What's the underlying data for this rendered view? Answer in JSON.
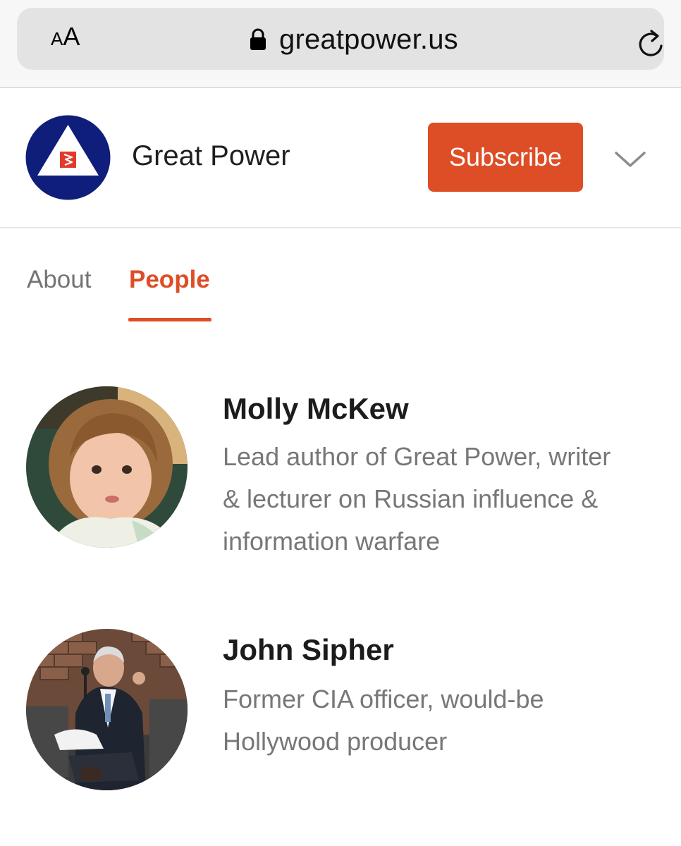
{
  "browser": {
    "text_size_small": "A",
    "text_size_large": "A",
    "url": "greatpower.us"
  },
  "site": {
    "title": "Great Power",
    "subscribe_label": "Subscribe",
    "accent_color": "#dd4e27",
    "logo_colors": {
      "ring": "#0f1e7a",
      "triangle": "#ffffff",
      "emblem": "#e23a2c"
    }
  },
  "tabs": [
    {
      "label": "About",
      "active": false
    },
    {
      "label": "People",
      "active": true
    }
  ],
  "people": [
    {
      "name": "Molly McKew",
      "bio_lines": [
        "Lead author of Great Power, writer",
        "& lecturer on Russian influence &",
        "information warfare"
      ],
      "avatar_icon": "child-portrait-photo"
    },
    {
      "name": "John Sipher",
      "bio_lines": [
        "Former CIA officer, would-be",
        "Hollywood producer"
      ],
      "avatar_icon": "seated-speaker-photo"
    }
  ]
}
